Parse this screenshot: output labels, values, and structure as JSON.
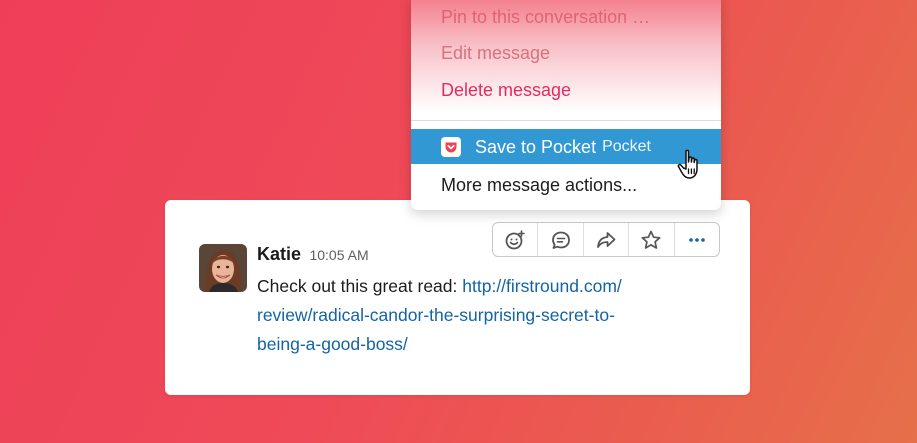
{
  "menu": {
    "items": [
      {
        "label": "Pin to this conversation …"
      },
      {
        "label": "Edit message"
      },
      {
        "label": "Delete message"
      }
    ],
    "save_to_pocket": {
      "label": "Save to Pocket",
      "app": "Pocket",
      "icon": "pocket-icon"
    },
    "more_actions": {
      "label": "More message actions..."
    }
  },
  "message": {
    "author": "Katie",
    "time": "10:05 AM",
    "text": "Check out this great read:",
    "link": "http://firstround.com/review/radical-candor-the-surprising-secret-to-being-a-good-boss/",
    "link_lines": [
      "http://firstround.com/",
      "review/radical-candor-the-surprising-secret-to-",
      "being-a-good-boss/"
    ]
  },
  "actions": [
    {
      "icon": "add-reaction-icon"
    },
    {
      "icon": "reply-thread-icon"
    },
    {
      "icon": "share-icon"
    },
    {
      "icon": "star-icon"
    },
    {
      "icon": "more-actions-icon"
    }
  ],
  "colors": {
    "highlight": "#3198d3",
    "delete": "#e01e5a",
    "link": "#1264a3",
    "more_active": "#1264a3",
    "background_from": "#ee3f59",
    "background_to": "#e6704a"
  }
}
